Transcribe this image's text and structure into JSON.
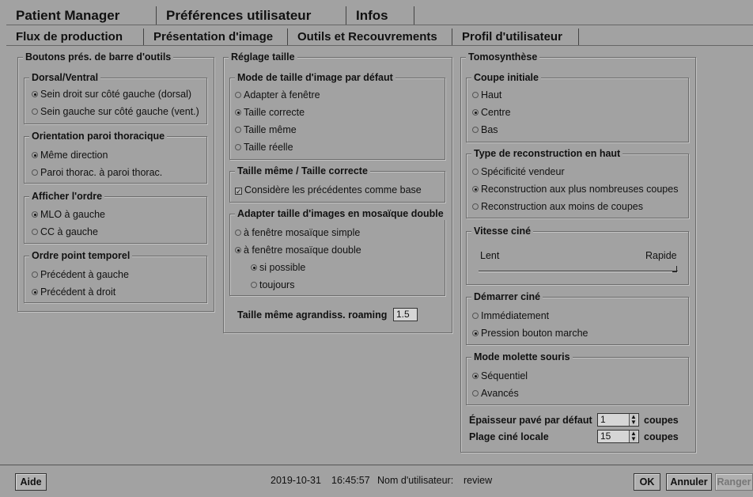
{
  "main_tabs": [
    "Patient Manager",
    "Préférences utilisateur",
    "Infos"
  ],
  "sub_tabs": [
    "Flux de production",
    "Présentation d'image",
    "Outils et Recouvrements",
    "Profil d'utilisateur"
  ],
  "toolbar_group": {
    "title": "Boutons prés. de barre d'outils",
    "dorsal": {
      "title": "Dorsal/Ventral",
      "options": [
        "Sein droit sur côté gauche (dorsal)",
        "Sein gauche sur côté gauche (vent.)"
      ],
      "selected": 0
    },
    "orientation": {
      "title": "Orientation paroi thoracique",
      "options": [
        "Même direction",
        "Paroi thorac. à paroi thorac."
      ],
      "selected": 0
    },
    "order": {
      "title": "Afficher l'ordre",
      "options": [
        "MLO à gauche",
        "CC à gauche"
      ],
      "selected": 0
    },
    "timepoint": {
      "title": "Ordre point temporel",
      "options": [
        "Précédent à gauche",
        "Précédent à droit"
      ],
      "selected": 1
    }
  },
  "size_group": {
    "title": "Réglage taille",
    "default_mode": {
      "title": "Mode de taille d'image par défaut",
      "options": [
        "Adapter à fenêtre",
        "Taille correcte",
        "Taille même",
        "Taille réelle"
      ],
      "selected": 1
    },
    "same_correct": {
      "title": "Taille même / Taille correcte",
      "checkbox_label": "Considère les précédentes comme base",
      "checked": true
    },
    "mosaic": {
      "title": "Adapter taille d'images en mosaïque double",
      "options": [
        "à fenêtre mosaïque simple",
        "à fenêtre mosaïque double"
      ],
      "selected": 1,
      "sub_options": [
        "si possible",
        "toujours"
      ],
      "sub_selected": 0
    },
    "roaming_label": "Taille même agrandiss. roaming",
    "roaming_value": "1.5"
  },
  "tomo_group": {
    "title": "Tomosynthèse",
    "initial_slice": {
      "title": "Coupe initiale",
      "options": [
        "Haut",
        "Centre",
        "Bas"
      ],
      "selected": 1
    },
    "reconstruction": {
      "title": "Type de reconstruction en haut",
      "options": [
        "Spécificité vendeur",
        "Reconstruction aux plus nombreuses coupes",
        "Reconstruction aux moins de coupes"
      ],
      "selected": 1
    },
    "cine_speed": {
      "title": "Vitesse ciné",
      "slow_label": "Lent",
      "fast_label": "Rapide",
      "value": 1.0
    },
    "cine_start": {
      "title": "Démarrer ciné",
      "options": [
        "Immédiatement",
        "Pression bouton marche"
      ],
      "selected": 1
    },
    "wheel_mode": {
      "title": "Mode molette souris",
      "options": [
        "Séquentiel",
        "Avancés"
      ],
      "selected": 0
    },
    "slab_label": "Épaisseur pavé par défaut",
    "slab_value": "1",
    "cine_range_label": "Plage ciné locale",
    "cine_range_value": "15",
    "unit": "coupes"
  },
  "footer": {
    "help": "Aide",
    "date": "2019-10-31",
    "time": "16:45:57",
    "user_label": "Nom d'utilisateur:",
    "user": "review",
    "ok": "OK",
    "cancel": "Annuler",
    "store": "Ranger"
  }
}
